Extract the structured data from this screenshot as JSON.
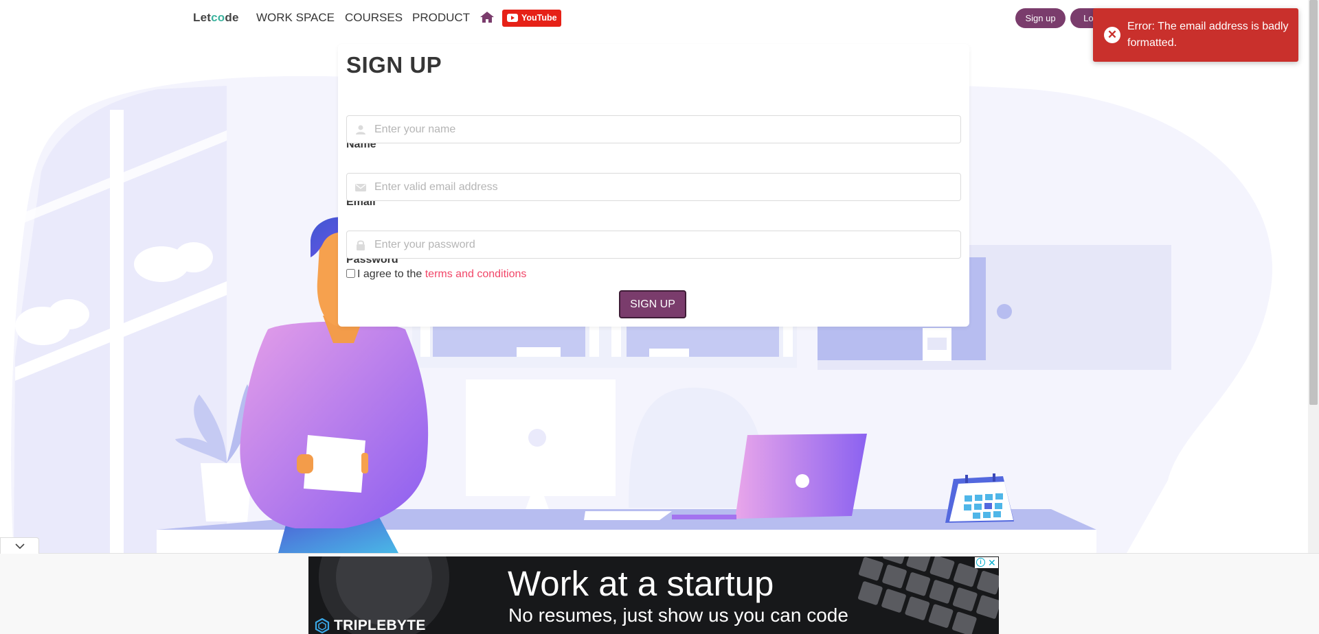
{
  "navbar": {
    "logo": {
      "pre": "Let",
      "accent": "c",
      "glyph": "o",
      "post": "de"
    },
    "items": [
      "WORK SPACE",
      "COURSES",
      "PRODUCT"
    ],
    "home_icon": "home-icon",
    "youtube_label": "YouTube",
    "signup_label": "Sign up",
    "login_label": "Log"
  },
  "form": {
    "title": "SIGN UP",
    "name": {
      "label": "Name",
      "placeholder": "Enter your name",
      "icon": "user-icon"
    },
    "email": {
      "label": "Email",
      "placeholder": "Enter valid email address",
      "icon": "envelope-icon"
    },
    "password": {
      "label": "Password",
      "placeholder": "Enter your password",
      "icon": "lock-icon"
    },
    "agree": {
      "text": "I agree to the ",
      "link": "terms and conditions",
      "checked": false
    },
    "submit_label": "SIGN UP"
  },
  "toast": {
    "message": "Error: The email address is badly formatted.",
    "icon": "error-circle-icon",
    "color": "#c9302c"
  },
  "ad": {
    "headline": "Work at a startup",
    "subline": "No resumes, just show us you can code",
    "brand": "TRIPLEBYTE"
  },
  "colors": {
    "accent": "#7a3c6c",
    "link": "#f14668",
    "youtube": "#e62117"
  }
}
